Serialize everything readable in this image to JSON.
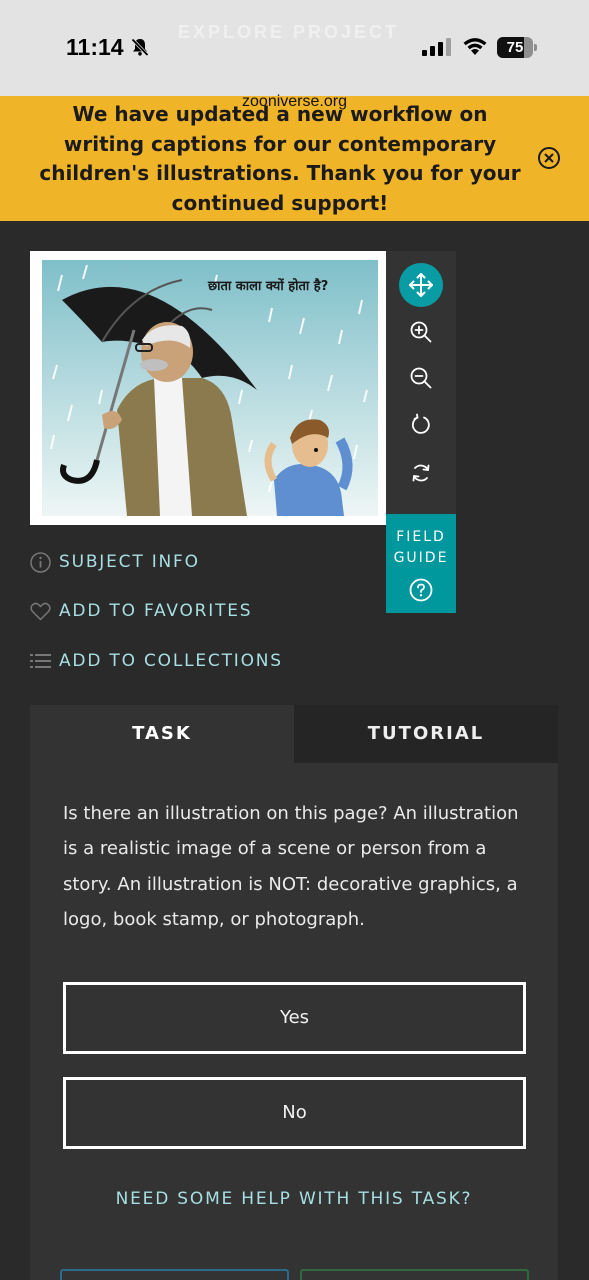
{
  "status_bar": {
    "time": "11:14",
    "battery_level": "75",
    "explore_ghost": "EXPLORE PROJECT"
  },
  "browser": {
    "url": "zooniverse.org"
  },
  "banner": {
    "message": "We have updated a new workflow on writing captions for our contemporary children's illustrations. Thank you for your continued support!",
    "color": "#f0b429"
  },
  "subject": {
    "caption": "छाता काला क्यों होता है?"
  },
  "field_guide": {
    "label_line1": "FIELD",
    "label_line2": "GUIDE"
  },
  "meta_links": {
    "subject_info": "SUBJECT INFO",
    "add_to_favorites": "ADD TO FAVORITES",
    "add_to_collections": "ADD TO COLLECTIONS"
  },
  "tabs": {
    "task": "TASK",
    "tutorial": "TUTORIAL"
  },
  "task": {
    "question": "Is there an illustration on this page? An illustration is a realistic image of a scene or person from a story. An illustration is NOT: decorative graphics, a logo, book stamp, or photograph.",
    "answers": [
      "Yes",
      "No"
    ],
    "help": "NEED SOME HELP WITH THIS TASK?"
  },
  "colors": {
    "accent_teal": "#00979d",
    "link_teal": "#a7dfe3",
    "panel": "#333333",
    "background": "#2a2a2a"
  }
}
